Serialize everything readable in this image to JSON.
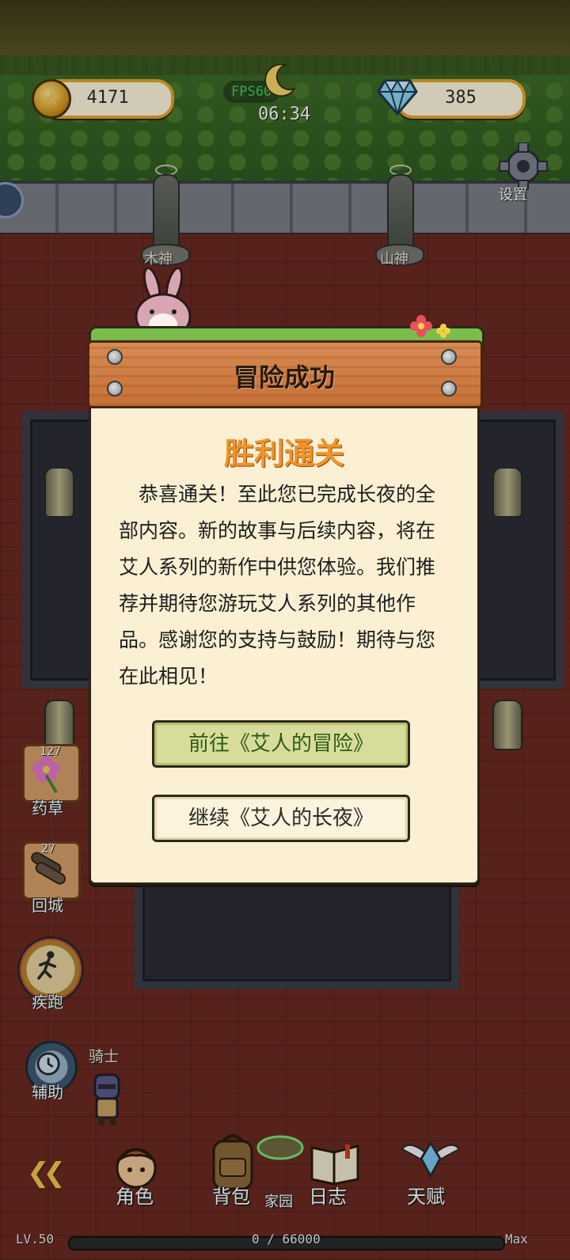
{
  "hud": {
    "coins": "4171",
    "gems": "385",
    "fps": "FPS60",
    "clock": "06:34",
    "settings_label": "设置"
  },
  "statues": [
    {
      "label": "木神"
    },
    {
      "label": "山神"
    }
  ],
  "side_tools": {
    "herb": {
      "count": "127",
      "label": "药草"
    },
    "return_city": {
      "count": "27",
      "label": "回城"
    },
    "sprint": {
      "label": "疾跑"
    },
    "assist": {
      "label": "辅助"
    }
  },
  "player": {
    "name": "骑士"
  },
  "dialog": {
    "header": "冒险成功",
    "title": "胜利通关",
    "message": "恭喜通关！至此您已完成长夜的全部内容。新的故事与后续内容，将在艾人系列的新作中供您体验。我们推荐并期待您游玩艾人系列的其他作品。感谢您的支持与鼓励！期待与您在此相见！",
    "primary_button": "前往《艾人的冒险》",
    "secondary_button": "继续《艾人的长夜》"
  },
  "bottom_nav": {
    "items": [
      {
        "label": "角色",
        "icon": "character-portrait-icon"
      },
      {
        "label": "背包",
        "icon": "backpack-icon"
      },
      {
        "label": "家园",
        "icon": "home-portal-icon"
      },
      {
        "label": "日志",
        "icon": "journal-book-icon"
      },
      {
        "label": "天赋",
        "icon": "winged-gem-icon"
      }
    ]
  },
  "level": {
    "label": "LV.50",
    "xp": "0 / 66000",
    "max": "Max",
    "xp_fraction": 0
  },
  "colors": {
    "accent_orange": "#f0932a",
    "coin_border": "#e2a92a",
    "go_button": "#d8dc9a",
    "fps_green": "#3fd060"
  }
}
